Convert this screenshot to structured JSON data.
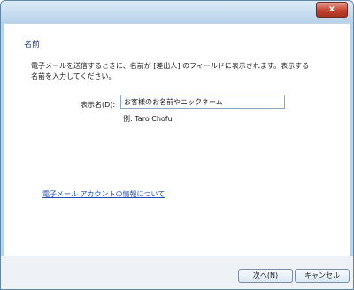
{
  "window": {
    "close_label": "x"
  },
  "page": {
    "heading": "名前",
    "description": "電子メールを送信するときに、名前が [差出人] のフィールドに表示されます。表示する名前を入力してください。",
    "display_name_label": "表示名(D):",
    "display_name_value": "お客様のお名前やニックネーム",
    "example": "例: Taro Chofu",
    "help_link": "電子メール アカウントの情報について"
  },
  "buttons": {
    "next": "次へ(N)",
    "cancel": "キャンセル"
  },
  "icons": {
    "back": "back-arrow-icon",
    "close": "close-icon"
  }
}
